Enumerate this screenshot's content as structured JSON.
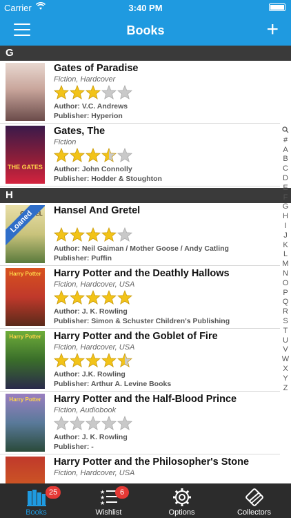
{
  "status_bar": {
    "carrier": "Carrier",
    "time": "3:40 PM"
  },
  "nav": {
    "title": "Books"
  },
  "colors": {
    "accent": "#1f9ae0",
    "star_fill": "#f2c318",
    "star_empty": "#c9c9c9",
    "loaned_ribbon": "#2f6ec9",
    "badge": "#e53935"
  },
  "sections": [
    {
      "letter": "G",
      "books": [
        {
          "title": "Gates of Paradise",
          "genre": "Fiction, Hardcover",
          "rating": 3,
          "author": "Author: V.C. Andrews",
          "publisher": "Publisher: Hyperion",
          "cover_text": "",
          "loaned": ""
        },
        {
          "title": "Gates, The",
          "genre": "Fiction",
          "rating": 3.5,
          "author": "Author: John Connolly",
          "publisher": "Publisher: Hodder & Stoughton",
          "cover_text": "THE GATES",
          "loaned": ""
        }
      ]
    },
    {
      "letter": "H",
      "books": [
        {
          "title": "Hansel And Gretel",
          "genre": "",
          "rating": 4,
          "author": "Author: Neil Gaiman / Mother Goose / Andy Catling",
          "publisher": "Publisher: Puffin",
          "cover_text": "GRETEL",
          "loaned": "Loaned"
        },
        {
          "title": "Harry Potter and the Deathly Hallows",
          "genre": "Fiction, Hardcover, USA",
          "rating": 5,
          "author": "Author: J. K. Rowling",
          "publisher": "Publisher: Simon & Schuster Children's Publishing",
          "cover_text": "Harry Potter",
          "loaned": ""
        },
        {
          "title": "Harry Potter and the Goblet of Fire",
          "genre": "Fiction, Hardcover, USA",
          "rating": 4.5,
          "author": "Author: J.K. Rowling",
          "publisher": "Publisher: Arthur A. Levine Books",
          "cover_text": "Harry Potter",
          "loaned": ""
        },
        {
          "title": "Harry Potter and the Half-Blood Prince",
          "genre": "Fiction, Audiobook",
          "rating": 0,
          "author": "Author: J. K. Rowling",
          "publisher": "Publisher: -",
          "cover_text": "Harry Potter",
          "loaned": ""
        },
        {
          "title": "Harry Potter and the Philosopher's Stone",
          "genre": "Fiction, Hardcover, USA",
          "rating": 0,
          "author": "",
          "publisher": "",
          "cover_text": "",
          "loaned": ""
        }
      ]
    }
  ],
  "index_letters": [
    "Q",
    "#",
    "A",
    "B",
    "C",
    "D",
    "E",
    "F",
    "G",
    "H",
    "I",
    "J",
    "K",
    "L",
    "M",
    "N",
    "O",
    "P",
    "Q",
    "R",
    "S",
    "T",
    "U",
    "V",
    "W",
    "X",
    "Y",
    "Z"
  ],
  "tabs": [
    {
      "label": "Books",
      "icon": "books-icon",
      "badge": "25",
      "active": true
    },
    {
      "label": "Wishlist",
      "icon": "wishlist-icon",
      "badge": "6",
      "active": false
    },
    {
      "label": "Options",
      "icon": "gear-icon",
      "badge": "",
      "active": false
    },
    {
      "label": "Collectors",
      "icon": "collectors-icon",
      "badge": "",
      "active": false
    }
  ]
}
